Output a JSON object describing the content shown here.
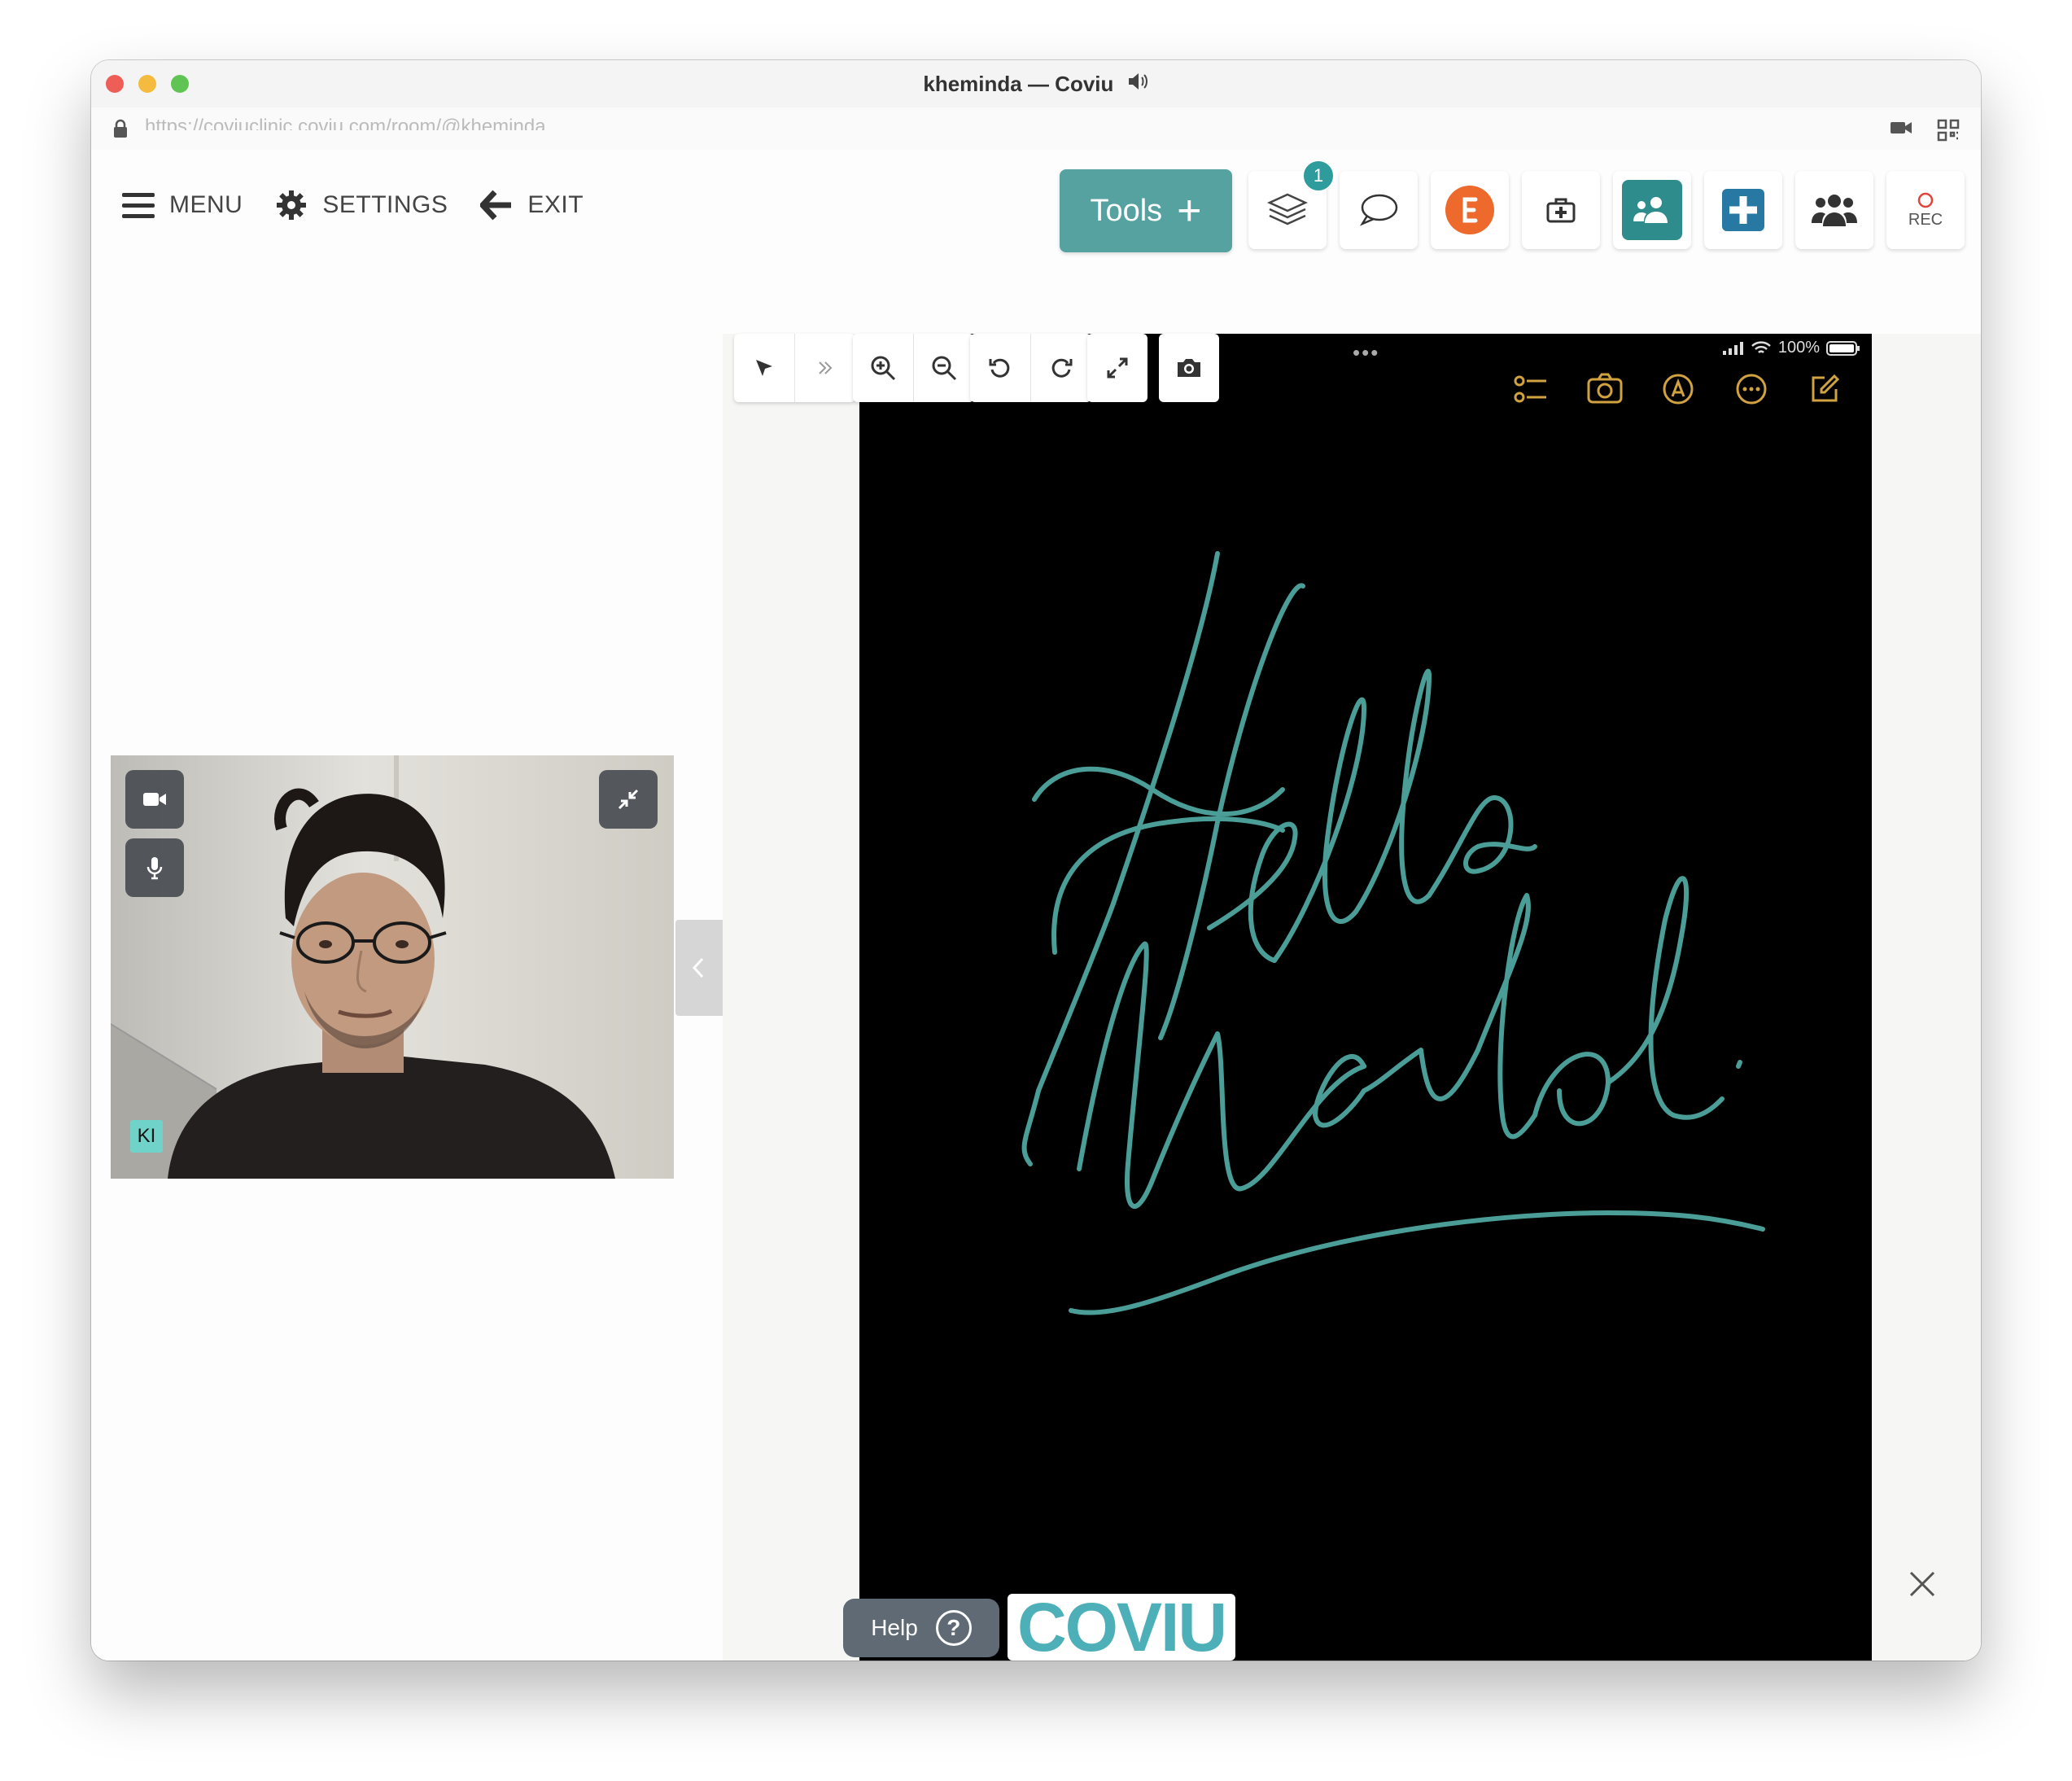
{
  "window": {
    "title": "kheminda — Coviu",
    "url": "https://coviuclinic.coviu.com/room/@kheminda"
  },
  "nav": {
    "menu_label": "MENU",
    "settings_label": "SETTINGS",
    "exit_label": "EXIT"
  },
  "toolbar": {
    "tools_label": "Tools",
    "layers_badge": "1",
    "rec_label": "REC"
  },
  "participant": {
    "initials": "KI"
  },
  "device_status": {
    "battery": "100%"
  },
  "help": {
    "label": "Help"
  },
  "brand": {
    "logo_text": "COVIU",
    "accent": "#55a2a1",
    "handwriting": "#4a9e97"
  }
}
